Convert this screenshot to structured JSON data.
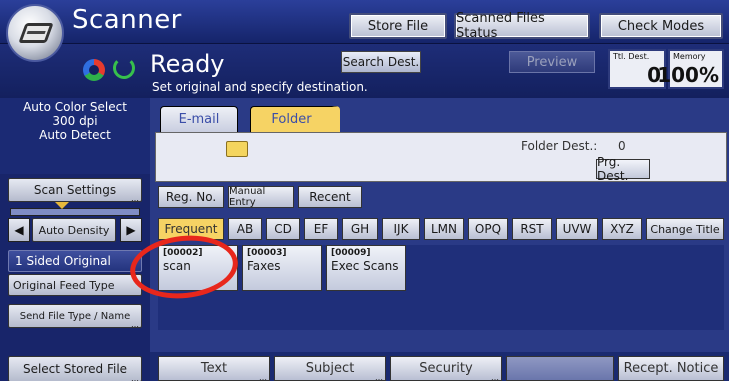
{
  "header": {
    "app_title": "Scanner",
    "store_file": "Store File",
    "scanned_files_status": "Scanned Files Status",
    "check_modes": "Check Modes"
  },
  "status": {
    "ready": "Ready",
    "instruction": "Set original and specify destination.",
    "search_dest": "Search Dest.",
    "preview": "Preview",
    "ttl_dest_label": "Ttl. Dest.",
    "ttl_dest_value": "0",
    "memory_label": "Memory",
    "memory_value": "100%"
  },
  "sidebar": {
    "summary": [
      "Auto Color Select",
      "300 dpi",
      "Auto Detect"
    ],
    "scan_settings": "Scan Settings",
    "auto_density": "Auto Density",
    "density_level": 0.4,
    "sided_original": "1 Sided Original",
    "original_feed_type": "Original Feed Type",
    "send_file_type": "Send File Type / Name",
    "select_stored_file": "Select Stored File"
  },
  "tabs": {
    "email": "E-mail",
    "folder": "Folder"
  },
  "folder_panel": {
    "folder_dest_label": "Folder Dest.:",
    "folder_dest_value": "0",
    "prg_dest": "Prg. Dest."
  },
  "modes": {
    "reg_no": "Reg. No.",
    "manual_entry": "Manual Entry",
    "recent": "Recent"
  },
  "index": {
    "frequent": "Frequent",
    "letters": [
      "AB",
      "CD",
      "EF",
      "GH",
      "IJK",
      "LMN",
      "OPQ",
      "RST",
      "UVW",
      "XYZ"
    ],
    "change_title": "Change Title"
  },
  "destinations": [
    {
      "num": "[00002]",
      "name": "scan"
    },
    {
      "num": "[00003]",
      "name": "Faxes"
    },
    {
      "num": "[00009]",
      "name": "Exec Scans"
    }
  ],
  "bottom": {
    "text": "Text",
    "subject": "Subject",
    "security": "Security",
    "recept_notice": "Recept. Notice"
  },
  "colors": {
    "annotation_circle": "#e8271c",
    "active_tab": "#f6d364"
  }
}
